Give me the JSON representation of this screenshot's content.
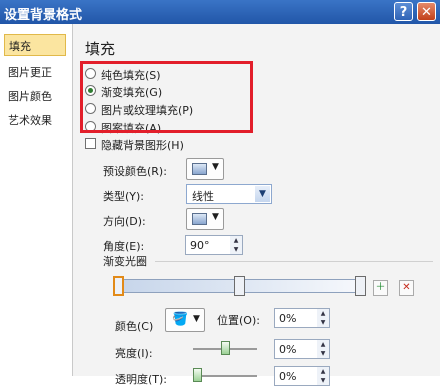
{
  "window": {
    "title": "设置背景格式",
    "help_label": "?",
    "close_label": "✕"
  },
  "sidebar": {
    "items": [
      {
        "label": "填充",
        "selected": true
      },
      {
        "label": "图片更正"
      },
      {
        "label": "图片颜色"
      },
      {
        "label": "艺术效果"
      }
    ]
  },
  "main": {
    "heading": "填充",
    "fill_options": [
      {
        "label": "纯色填充(S)",
        "checked": false
      },
      {
        "label": "渐变填充(G)",
        "checked": true
      },
      {
        "label": "图片或纹理填充(P)",
        "checked": false
      },
      {
        "label": "图案填充(A)",
        "checked": false
      }
    ],
    "hide_bg_label": "隐藏背景图形(H)",
    "preset_label": "预设颜色(R):",
    "type_label": "类型(Y):",
    "type_value": "线性",
    "direction_label": "方向(D):",
    "angle_label": "角度(E):",
    "angle_value": "90°",
    "stops_label": "渐变光圈",
    "color_label": "颜色(C)",
    "position_label": "位置(O):",
    "position_value": "0%",
    "brightness_label": "亮度(I):",
    "brightness_value": "0%",
    "transparency_label": "透明度(T):",
    "transparency_value": "0%"
  },
  "colors": {
    "title_bar": "#2c63b8",
    "highlight": "#e21e2a",
    "selected_item": "#fbe5a0"
  }
}
